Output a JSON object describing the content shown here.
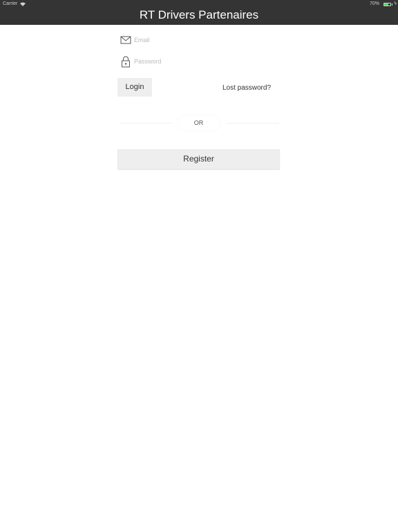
{
  "status_bar": {
    "carrier": "Carrier",
    "battery_percent": "70%",
    "battery_level": 0.7,
    "battery_color": "#4cd964"
  },
  "nav_bar": {
    "title": "RT Drivers Partenaires",
    "background": "#343434"
  },
  "form": {
    "email": {
      "placeholder": "Email",
      "value": "",
      "icon": "envelope-icon"
    },
    "password": {
      "placeholder": "Password",
      "value": "",
      "icon": "lock-icon"
    },
    "login_label": "Login",
    "lost_password_label": "Lost password?",
    "or_label": "OR",
    "register_label": "Register"
  }
}
